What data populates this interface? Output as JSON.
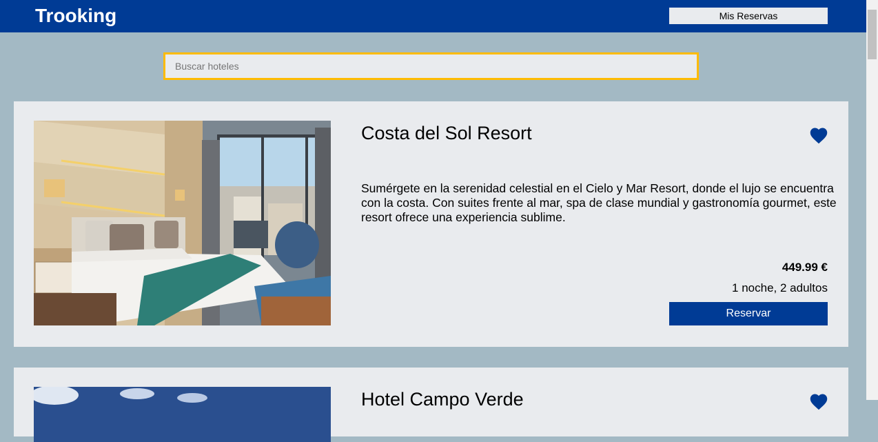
{
  "header": {
    "brand": "Trooking",
    "my_bookings_label": "Mis Reservas",
    "color": "#003b95"
  },
  "search": {
    "placeholder": "Buscar hoteles",
    "value": ""
  },
  "hotels": [
    {
      "name": "Costa del Sol Resort",
      "description": "Sumérgete en la serenidad celestial en el Cielo y Mar Resort, donde el lujo se encuentra con la costa. Con suites frente al mar, spa de clase mundial y gastronomía gourmet, este resort ofrece una experiencia sublime.",
      "price": "449.99 €",
      "stay": "1 noche, 2 adultos",
      "book_label": "Reservar",
      "favorite": true,
      "image": "hotel-room-photo"
    },
    {
      "name": "Hotel Campo Verde",
      "favorite": true,
      "image": "sky-photo"
    }
  ],
  "colors": {
    "background": "#a3b9c4",
    "card": "#e9ebee",
    "primary": "#003b95",
    "search_border": "#febb02"
  },
  "icons": [
    "heart-icon"
  ]
}
